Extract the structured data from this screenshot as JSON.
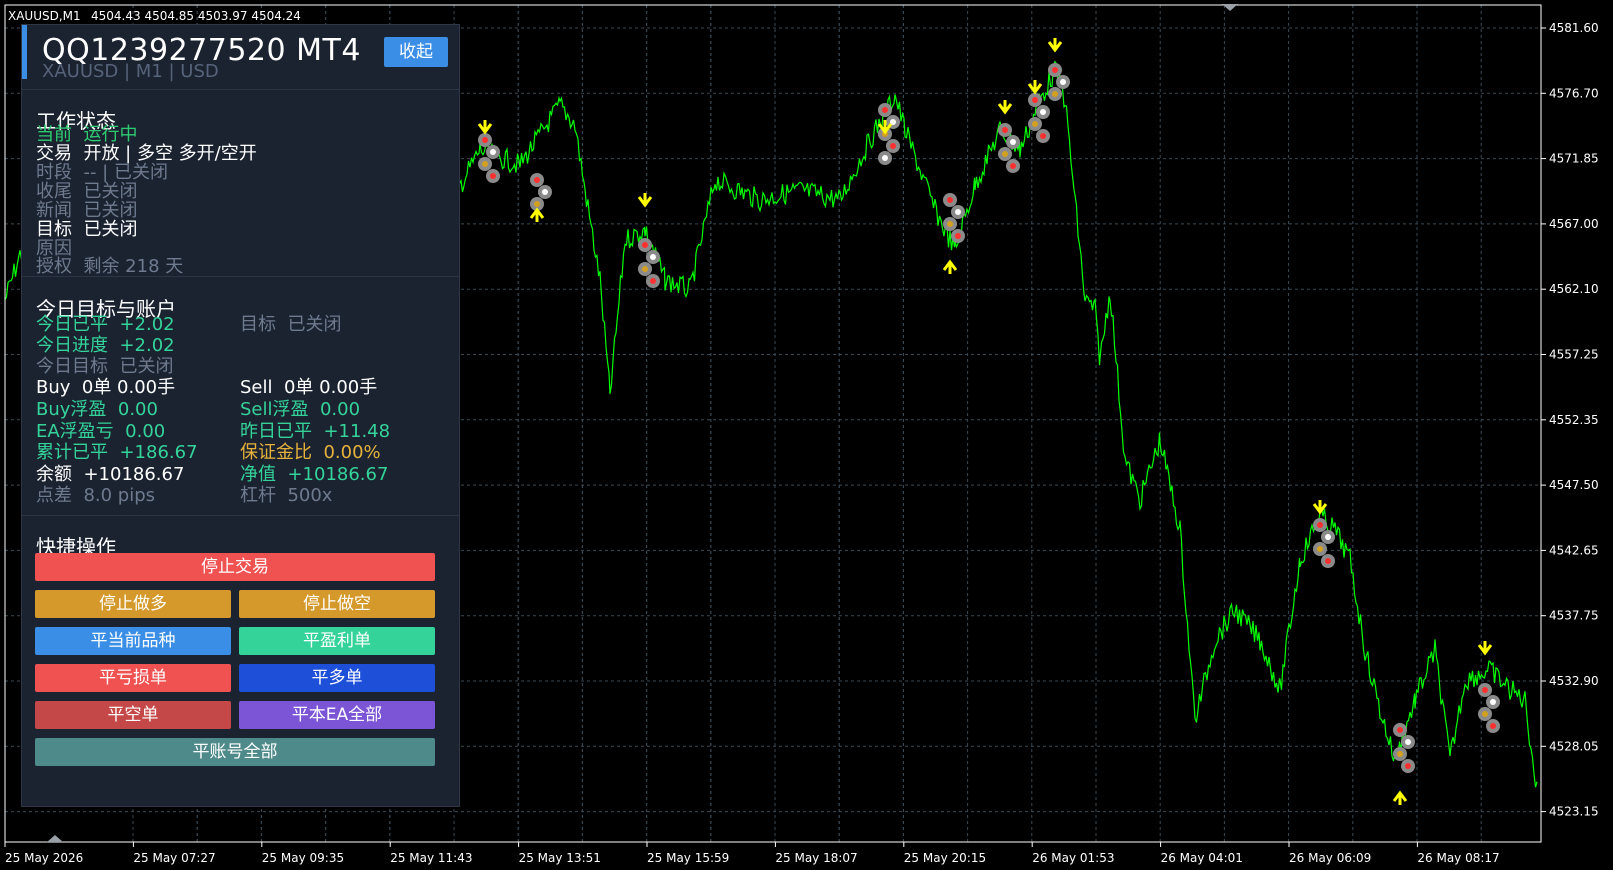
{
  "chart_header": {
    "symbol": "XAUUSD,M1",
    "ohlc": "4504.43 4504.85 4503.97 4504.24"
  },
  "price_axis": [
    "4581.60",
    "4576.70",
    "4571.85",
    "4567.00",
    "4562.10",
    "4557.25",
    "4552.35",
    "4547.50",
    "4542.65",
    "4537.75",
    "4532.90",
    "4528.05",
    "4523.15"
  ],
  "time_axis": [
    "25 May 2026",
    "25 May 07:27",
    "25 May 09:35",
    "25 May 11:43",
    "25 May 13:51",
    "25 May 15:59",
    "25 May 18:07",
    "25 May 20:15",
    "26 May 01:53",
    "26 May 04:01",
    "26 May 06:09",
    "26 May 08:17"
  ],
  "colors": {
    "price_line": "#00ff00",
    "arrow": "#ffff00",
    "panel_bg": "#1b2331",
    "accent": "#3a8ee6"
  },
  "panel": {
    "title": "QQ1239277520 MT4",
    "subtitle": "XAUUSD | M1 | USD",
    "collapse_label": "收起",
    "status": {
      "title": "工作状态",
      "current_label": "当前",
      "current_value": "运行中",
      "trade_label": "交易",
      "trade_value": "开放 | 多空  多开/空开",
      "session_label": "时段",
      "session_value": "-- | 已关闭",
      "close_label": "收尾",
      "close_value": "已关闭",
      "news_label": "新闻",
      "news_value": "已关闭",
      "target_label": "目标",
      "target_value": "已关闭",
      "reason_label": "原因",
      "license_label": "授权",
      "license_value": "剩余 218 天"
    },
    "account": {
      "title": "今日目标与账户",
      "today_closed_label": "今日已平",
      "today_closed_value": "+2.02",
      "target_label": "目标",
      "target_value": "已关闭",
      "progress_label": "今日进度",
      "progress_value": "+2.02",
      "today_target_label": "今日目标",
      "today_target_value": "已关闭",
      "buy_label": "Buy",
      "buy_value": "0单  0.00手",
      "sell_label": "Sell",
      "sell_value": "0单  0.00手",
      "buy_float_label": "Buy浮盈",
      "buy_float_value": "0.00",
      "sell_float_label": "Sell浮盈",
      "sell_float_value": "0.00",
      "ea_float_label": "EA浮盈亏",
      "ea_float_value": "0.00",
      "yesterday_label": "昨日已平",
      "yesterday_value": "+11.48",
      "total_closed_label": "累计已平",
      "total_closed_value": "+186.67",
      "margin_label": "保证金比",
      "margin_value": "0.00%",
      "balance_label": "余额",
      "balance_value": "+10186.67",
      "equity_label": "净值",
      "equity_value": "+10186.67",
      "spread_label": "点差",
      "spread_value": "8.0 pips",
      "leverage_label": "杠杆",
      "leverage_value": "500x"
    },
    "quick": {
      "title": "快捷操作",
      "stop_trading": "停止交易",
      "stop_long": "停止做多",
      "stop_short": "停止做空",
      "close_symbol": "平当前品种",
      "close_profit": "平盈利单",
      "close_loss": "平亏损单",
      "close_buy": "平多单",
      "close_sell": "平空单",
      "close_ea_all": "平本EA全部",
      "close_account_all": "平账号全部"
    }
  }
}
